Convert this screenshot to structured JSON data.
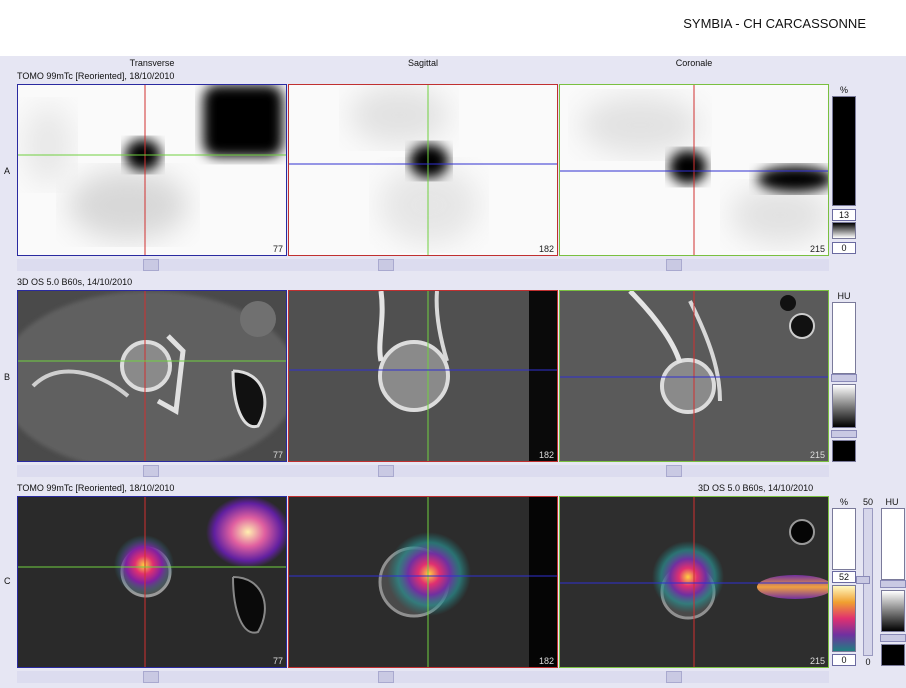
{
  "header": {
    "site": "SYMBIA - CH CARCASSONNE"
  },
  "columns": [
    "Transverse",
    "Sagittal",
    "Coronale"
  ],
  "rows": [
    {
      "label": "A",
      "series": "TOMO 99mTc [Reoriented], 18/10/2010",
      "slices": [
        "77",
        "182",
        "215"
      ]
    },
    {
      "label": "B",
      "series": "3D  OS  5.0  B60s, 14/10/2010",
      "slices": [
        "77",
        "182",
        "215"
      ]
    },
    {
      "label": "C",
      "series_left": "TOMO 99mTc [Reoriented], 18/10/2010",
      "series_right": "3D  OS  5.0  B60s, 14/10/2010",
      "slices": [
        "77",
        "182",
        "215"
      ]
    }
  ],
  "colorbars": {
    "a": {
      "unit": "%",
      "top_value": "13",
      "bottom_value": "0"
    },
    "b": {
      "unit": "HU"
    },
    "c": {
      "unit_left": "%",
      "value_mid": "50",
      "unit_right": "HU",
      "top_value": "52",
      "bottom_value": "0",
      "small_value": "0"
    }
  },
  "colors": {
    "transverse_frame": "#2a2aa0",
    "sagittal_frame": "#c03030",
    "coronal_frame": "#7ac040",
    "crosshair_red": "#d03030",
    "crosshair_green": "#70d040",
    "crosshair_blue": "#3030d0"
  }
}
